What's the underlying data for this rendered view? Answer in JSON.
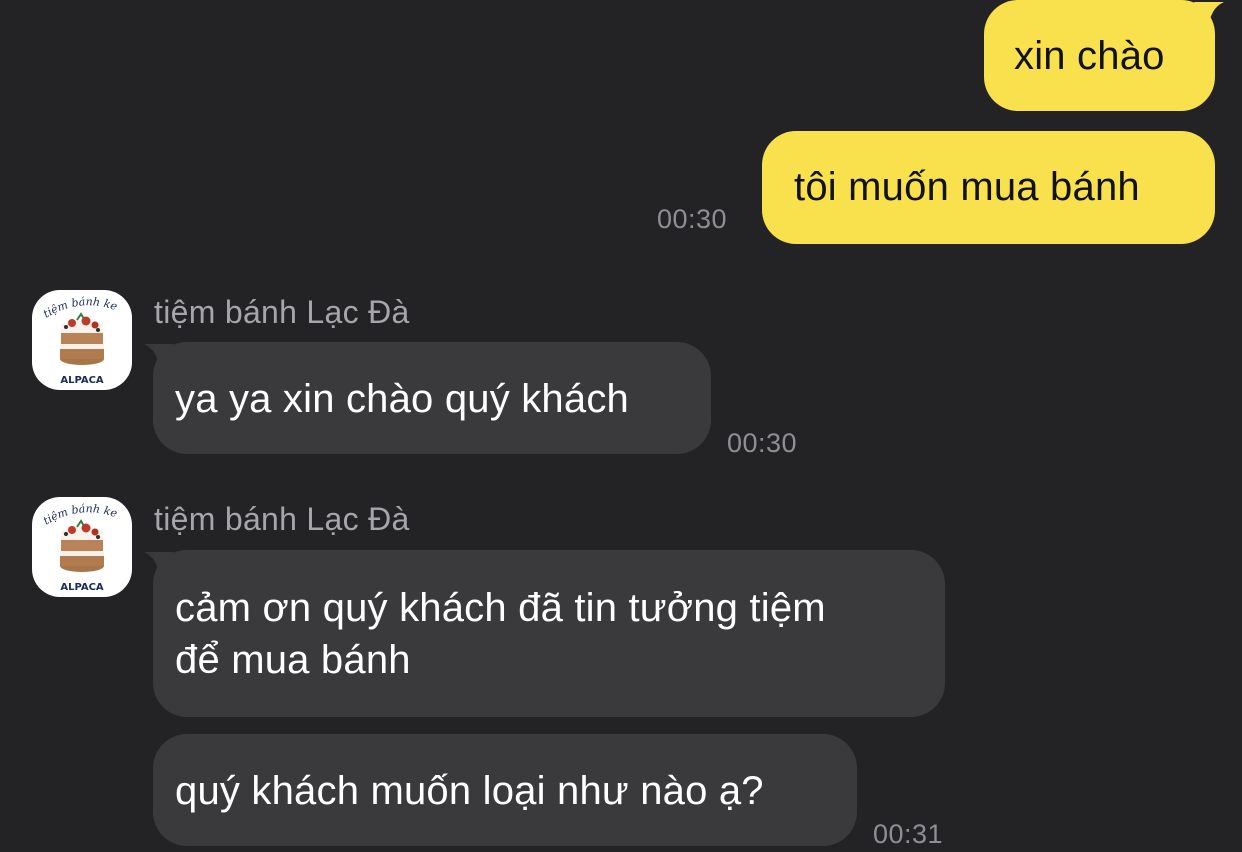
{
  "colors": {
    "background": "#232325",
    "outgoing_bubble": "#f9e04d",
    "incoming_bubble": "#3a3a3c",
    "timestamp": "#8e8e93",
    "sender_name": "#a5a5aa"
  },
  "outgoing": [
    {
      "text": "xin chào"
    },
    {
      "text": "tôi muốn mua bánh",
      "time": "00:30"
    }
  ],
  "groups": [
    {
      "sender": "tiệm bánh Lạc Đà",
      "avatar": {
        "top_text": "tiệm bánh kem",
        "bottom_text": "ALPACA",
        "icon": "cake-icon"
      },
      "messages": [
        {
          "text": "ya ya xin chào quý khách",
          "time": "00:30"
        }
      ]
    },
    {
      "sender": "tiệm bánh Lạc Đà",
      "avatar": {
        "top_text": "tiệm bánh kem",
        "bottom_text": "ALPACA",
        "icon": "cake-icon"
      },
      "messages": [
        {
          "text": "cảm ơn quý khách đã tin tưởng tiệm\nđể mua bánh"
        },
        {
          "text": "quý khách muốn loại như nào ạ?",
          "time": "00:31"
        }
      ]
    }
  ]
}
